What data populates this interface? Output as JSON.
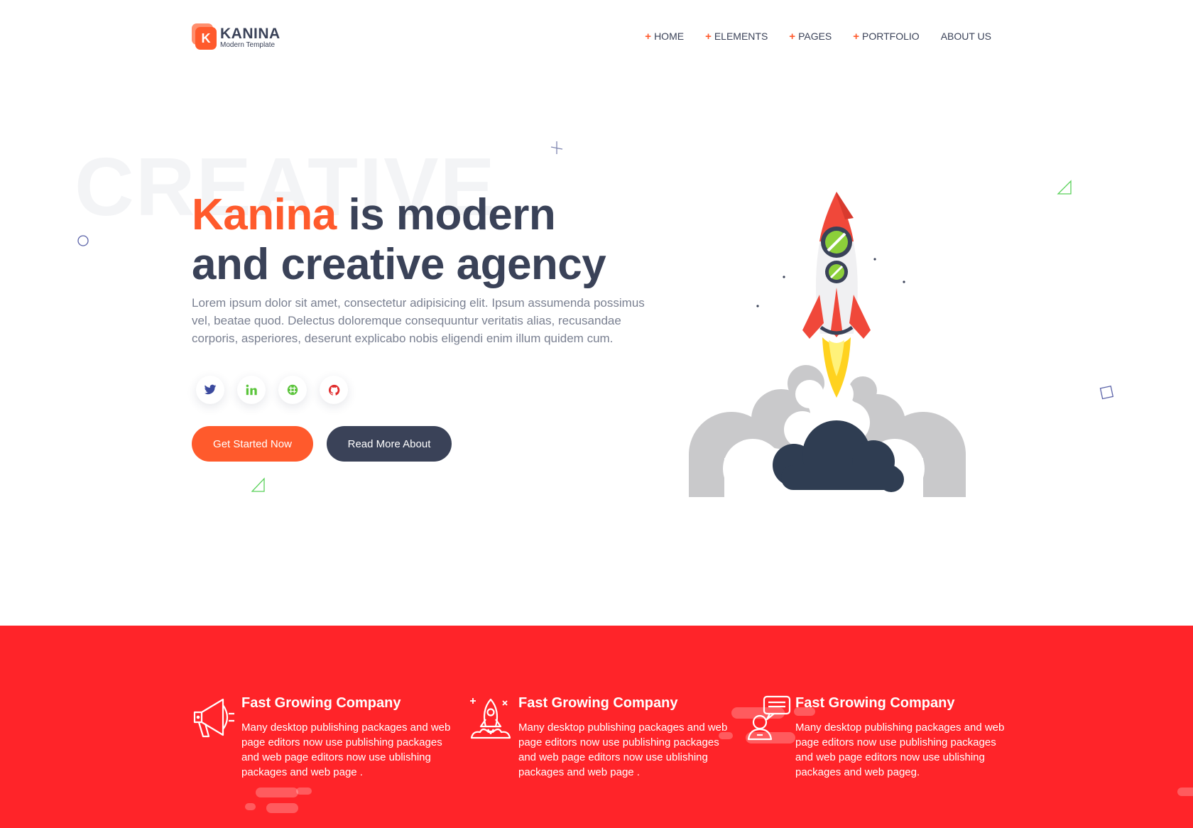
{
  "header": {
    "logo_letter": "K",
    "logo_name": "KANINA",
    "logo_sub": "Modern Template",
    "nav": [
      {
        "label": "HOME",
        "plus": true
      },
      {
        "label": "ELEMENTS",
        "plus": true
      },
      {
        "label": "PAGES",
        "plus": true
      },
      {
        "label": "PORTFOLIO",
        "plus": true
      },
      {
        "label": "ABOUT US",
        "plus": false
      }
    ]
  },
  "hero": {
    "bg_word": "CREATIVE",
    "title_accent": "Kanina",
    "title_line1_rest": " is modern",
    "title_line2": "and creative agency",
    "description": "Lorem ipsum dolor sit amet, consectetur adipisicing elit. Ipsum assumenda possimus vel, beatae quod. Delectus doloremque consequuntur veritatis alias, recusandae corporis, asperiores, deserunt explicabo nobis eligendi enim illum quidem cum.",
    "socials": [
      {
        "icon": "twitter-icon",
        "color": "#3b4a9e"
      },
      {
        "icon": "linkedin-icon",
        "color": "#5ac43a"
      },
      {
        "icon": "slack-icon",
        "color": "#5ac43a"
      },
      {
        "icon": "github-icon",
        "color": "#e02b2b"
      }
    ],
    "primary_button": "Get Started Now",
    "secondary_button": "Read More About"
  },
  "features": [
    {
      "icon": "megaphone-icon",
      "title": "Fast Growing Company",
      "text": "Many desktop publishing packages and web page editors now use publishing packages and web page editors now use ublishing packages and web page ."
    },
    {
      "icon": "rocket-icon",
      "title": "Fast Growing Company",
      "text": "Many desktop publishing packages and web page editors now use publishing packages and web page editors now use ublishing packages and web page ."
    },
    {
      "icon": "support-chat-icon",
      "title": "Fast Growing Company",
      "text": "Many desktop publishing packages and web page editors now use publishing packages and web page editors now use ublishing packages and web pageg."
    }
  ],
  "colors": {
    "accent": "#ff5a2c",
    "dark": "#3a4258",
    "band": "#ff2429"
  }
}
